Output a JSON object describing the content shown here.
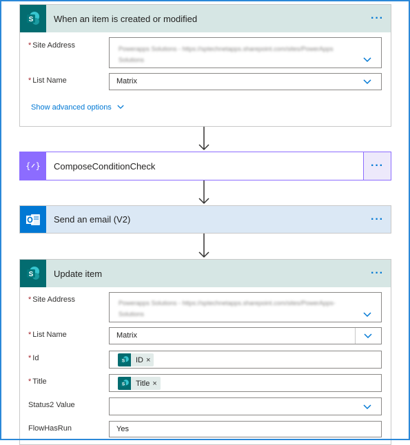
{
  "trigger": {
    "title": "When an item is created or modified",
    "menu": "···",
    "site_address_label": "Site Address",
    "site_address_value": "Powerapps Solutions - https://sptechnetapps.sharepoint.com/sites/PowerApps Solutions",
    "list_name_label": "List Name",
    "list_name_value": "Matrix",
    "advanced_label": "Show advanced options",
    "header_color": "#d6e6e4",
    "icon": "sharepoint-icon"
  },
  "compose": {
    "title": "ComposeConditionCheck",
    "menu": "···",
    "header_color": "#ede9fb",
    "icon": "compose-icon"
  },
  "email": {
    "title": "Send an email (V2)",
    "menu": "···",
    "header_color": "#dbe8f5",
    "icon": "outlook-icon"
  },
  "update": {
    "title": "Update item",
    "menu": "···",
    "header_color": "#d6e6e4",
    "icon": "sharepoint-icon",
    "site_address_label": "Site Address",
    "site_address_value": "Powerapps Solutions - https://sptechnetapps.sharepoint.com/sites/PowerApps-Solutions",
    "list_name_label": "List Name",
    "list_name_value": "Matrix",
    "id_label": "Id",
    "id_token": "ID",
    "title_label": "Title",
    "title_token": "Title",
    "status_label": "Status2 Value",
    "status_value": "",
    "flowhasrun_label": "FlowHasRun",
    "flowhasrun_value": "Yes",
    "token_remove": "×"
  },
  "colors": {
    "accent": "#0078d4",
    "sharepoint_teal": "#036c70",
    "compose_purple": "#8c6cff",
    "outlook_blue": "#0078d4",
    "required": "#a4262c"
  }
}
